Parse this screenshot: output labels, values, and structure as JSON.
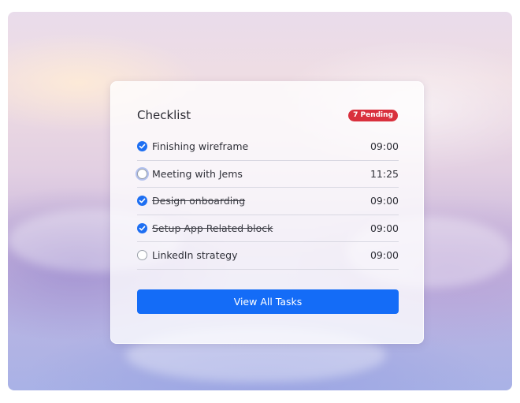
{
  "checklist": {
    "title": "Checklist",
    "pending_badge": "7 Pending",
    "tasks": [
      {
        "label": "Finishing wireframe",
        "time": "09:00",
        "checked": true,
        "struck": false
      },
      {
        "label": "Meeting with Jems",
        "time": "11:25",
        "checked": false,
        "struck": false
      },
      {
        "label": "Design onboarding",
        "time": "09:00",
        "checked": true,
        "struck": true
      },
      {
        "label": "Setup App Related block",
        "time": "09:00",
        "checked": true,
        "struck": true
      },
      {
        "label": "LinkedIn strategy",
        "time": "09:00",
        "checked": false,
        "struck": false
      }
    ],
    "view_all_label": "View All Tasks"
  },
  "colors": {
    "accent": "#146cf7",
    "badge": "#d9303d"
  }
}
